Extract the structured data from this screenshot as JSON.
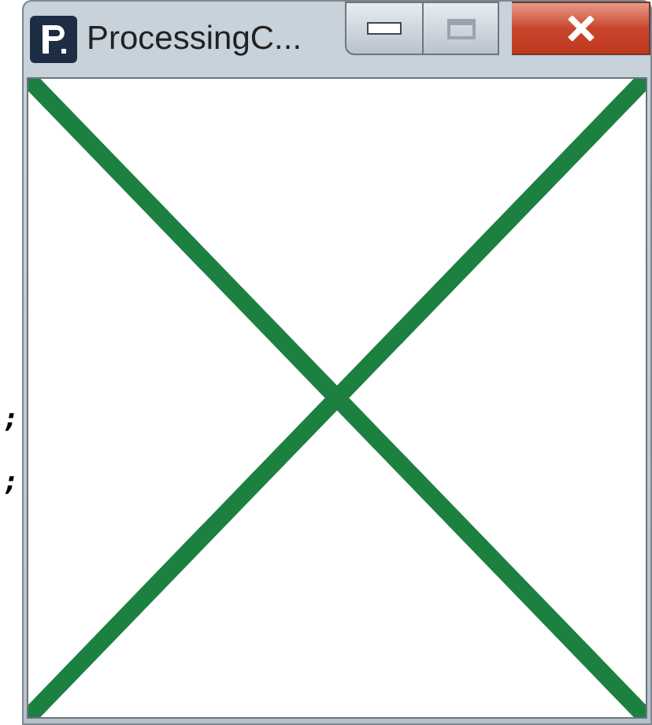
{
  "window": {
    "title": "ProcessingC..."
  },
  "background_text": [
    ";",
    ";"
  ]
}
